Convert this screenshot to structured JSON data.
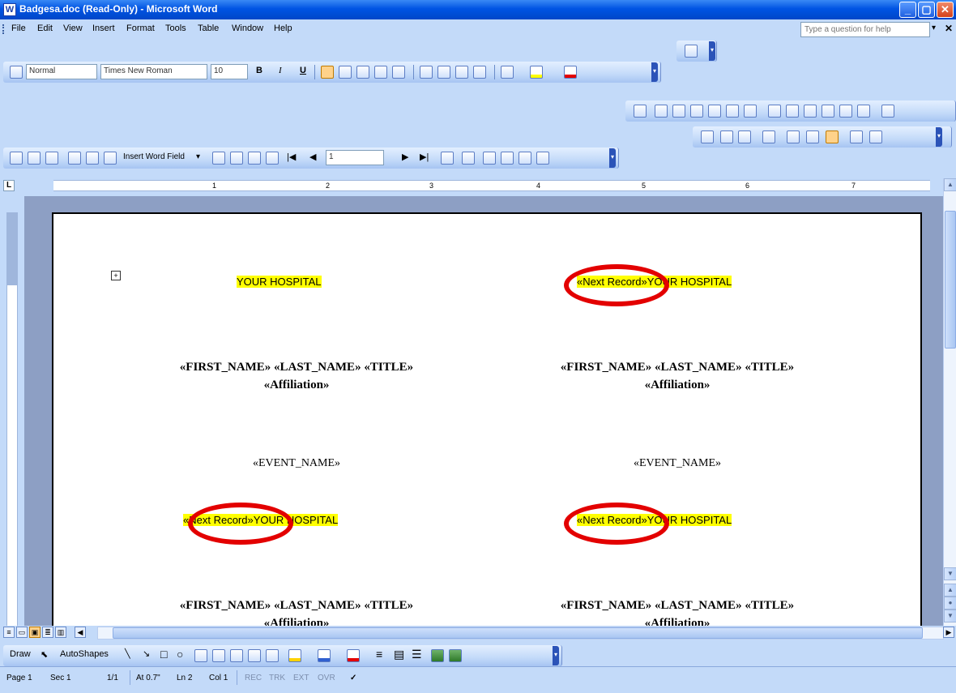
{
  "window": {
    "title": "Badgesa.doc (Read-Only) - Microsoft Word",
    "app_icon": "W"
  },
  "menu": {
    "items": [
      "File",
      "Edit",
      "View",
      "Insert",
      "Format",
      "Tools",
      "Table",
      "Window",
      "Help"
    ],
    "ask_placeholder": "Type a question for help"
  },
  "formatting": {
    "style": "Normal",
    "font": "Times New Roman",
    "size": "10",
    "bold": "B",
    "italic": "I",
    "underline": "U"
  },
  "mailmerge_toolbar": {
    "insert_word_field_label": "Insert Word Field",
    "record_number": "1"
  },
  "ruler": {
    "numbers": [
      "1",
      "2",
      "3",
      "4",
      "5",
      "6",
      "7"
    ]
  },
  "document": {
    "labels": [
      {
        "hospital_left": "YOUR HOSPITAL",
        "hospital_right": "«Next Record»YOUR HOSPITAL",
        "fields_line1": "«FIRST_NAME» «LAST_NAME» «TITLE»",
        "fields_line2": "«Affiliation»",
        "event": "«EVENT_NAME»"
      },
      {
        "hospital_left": "«Next Record»YOUR HOSPITAL",
        "hospital_right": "«Next Record»YOUR HOSPITAL",
        "fields_line1": "«FIRST_NAME» «LAST_NAME» «TITLE»",
        "fields_line2": "«Affiliation»"
      }
    ],
    "annotation_color": "#e30000",
    "highlight_color": "#ffff00"
  },
  "drawing": {
    "draw_label": "Draw",
    "autoshapes_label": "AutoShapes"
  },
  "status": {
    "page": "Page 1",
    "sec": "Sec 1",
    "pages": "1/1",
    "at": "At 0.7\"",
    "ln": "Ln 2",
    "col": "Col 1",
    "rec": "REC",
    "trk": "TRK",
    "ext": "EXT",
    "ovr": "OVR"
  },
  "icons": [
    "word-app-icon",
    "minimize-icon",
    "maximize-icon",
    "close-icon",
    "spellcheck-icon",
    "align-left-icon",
    "bullets-icon",
    "highlight-icon",
    "font-color-icon",
    "mailmerge-icon",
    "table-move-icon"
  ]
}
